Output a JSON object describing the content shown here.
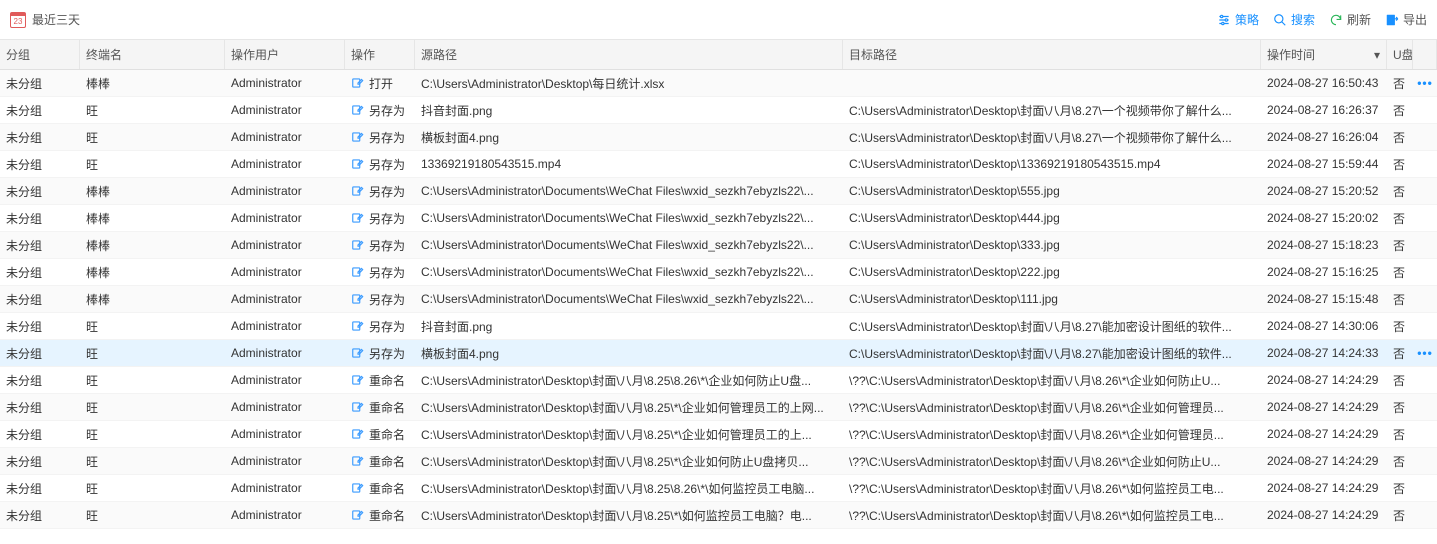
{
  "topbar": {
    "title": "最近三天",
    "cal_day": "23",
    "buttons": {
      "policy": "策略",
      "search": "搜索",
      "refresh": "刷新",
      "export": "导出"
    }
  },
  "columns": {
    "group": "分组",
    "terminal": "终端名",
    "user": "操作用户",
    "op": "操作",
    "src": "源路径",
    "dst": "目标路径",
    "time": "操作时间",
    "usb": "U盘"
  },
  "op_icons": {
    "open": {
      "stroke": "#4a90d9",
      "kind": "file"
    },
    "saveas": {
      "stroke": "#1890ff",
      "kind": "arrow-out"
    },
    "rename": {
      "stroke": "#1890ff",
      "kind": "edit"
    }
  },
  "rows": [
    {
      "group": "未分组",
      "terminal": "棒棒",
      "user": "Administrator",
      "op": "打开",
      "op_icon": "open",
      "src": "C:\\Users\\Administrator\\Desktop\\每日统计.xlsx",
      "dst": "",
      "time": "2024-08-27 16:50:43",
      "usb": "否",
      "menu": true
    },
    {
      "group": "未分组",
      "terminal": "旺",
      "user": "Administrator",
      "op": "另存为",
      "op_icon": "saveas",
      "src": "抖音封面.png",
      "dst": "C:\\Users\\Administrator\\Desktop\\封面\\八月\\8.27\\一个视频带你了解什么...",
      "time": "2024-08-27 16:26:37",
      "usb": "否"
    },
    {
      "group": "未分组",
      "terminal": "旺",
      "user": "Administrator",
      "op": "另存为",
      "op_icon": "saveas",
      "src": "横板封面4.png",
      "dst": "C:\\Users\\Administrator\\Desktop\\封面\\八月\\8.27\\一个视频带你了解什么...",
      "time": "2024-08-27 16:26:04",
      "usb": "否"
    },
    {
      "group": "未分组",
      "terminal": "旺",
      "user": "Administrator",
      "op": "另存为",
      "op_icon": "saveas",
      "src": "13369219180543515.mp4",
      "dst": "C:\\Users\\Administrator\\Desktop\\13369219180543515.mp4",
      "time": "2024-08-27 15:59:44",
      "usb": "否"
    },
    {
      "group": "未分组",
      "terminal": "棒棒",
      "user": "Administrator",
      "op": "另存为",
      "op_icon": "saveas",
      "src": "C:\\Users\\Administrator\\Documents\\WeChat Files\\wxid_sezkh7ebyzls22\\...",
      "dst": "C:\\Users\\Administrator\\Desktop\\555.jpg",
      "time": "2024-08-27 15:20:52",
      "usb": "否"
    },
    {
      "group": "未分组",
      "terminal": "棒棒",
      "user": "Administrator",
      "op": "另存为",
      "op_icon": "saveas",
      "src": "C:\\Users\\Administrator\\Documents\\WeChat Files\\wxid_sezkh7ebyzls22\\...",
      "dst": "C:\\Users\\Administrator\\Desktop\\444.jpg",
      "time": "2024-08-27 15:20:02",
      "usb": "否"
    },
    {
      "group": "未分组",
      "terminal": "棒棒",
      "user": "Administrator",
      "op": "另存为",
      "op_icon": "saveas",
      "src": "C:\\Users\\Administrator\\Documents\\WeChat Files\\wxid_sezkh7ebyzls22\\...",
      "dst": "C:\\Users\\Administrator\\Desktop\\333.jpg",
      "time": "2024-08-27 15:18:23",
      "usb": "否"
    },
    {
      "group": "未分组",
      "terminal": "棒棒",
      "user": "Administrator",
      "op": "另存为",
      "op_icon": "saveas",
      "src": "C:\\Users\\Administrator\\Documents\\WeChat Files\\wxid_sezkh7ebyzls22\\...",
      "dst": "C:\\Users\\Administrator\\Desktop\\222.jpg",
      "time": "2024-08-27 15:16:25",
      "usb": "否"
    },
    {
      "group": "未分组",
      "terminal": "棒棒",
      "user": "Administrator",
      "op": "另存为",
      "op_icon": "saveas",
      "src": "C:\\Users\\Administrator\\Documents\\WeChat Files\\wxid_sezkh7ebyzls22\\...",
      "dst": "C:\\Users\\Administrator\\Desktop\\111.jpg",
      "time": "2024-08-27 15:15:48",
      "usb": "否"
    },
    {
      "group": "未分组",
      "terminal": "旺",
      "user": "Administrator",
      "op": "另存为",
      "op_icon": "saveas",
      "src": "抖音封面.png",
      "dst": "C:\\Users\\Administrator\\Desktop\\封面\\八月\\8.27\\能加密设计图纸的软件...",
      "time": "2024-08-27 14:30:06",
      "usb": "否"
    },
    {
      "group": "未分组",
      "terminal": "旺",
      "user": "Administrator",
      "op": "另存为",
      "op_icon": "saveas",
      "src": "横板封面4.png",
      "dst": "C:\\Users\\Administrator\\Desktop\\封面\\八月\\8.27\\能加密设计图纸的软件...",
      "time": "2024-08-27 14:24:33",
      "usb": "否",
      "menu": true,
      "selected": true
    },
    {
      "group": "未分组",
      "terminal": "旺",
      "user": "Administrator",
      "op": "重命名",
      "op_icon": "rename",
      "src": "C:\\Users\\Administrator\\Desktop\\封面\\八月\\8.25\\8.26\\*\\企业如何防止U盘...",
      "dst": "\\??\\C:\\Users\\Administrator\\Desktop\\封面\\八月\\8.26\\*\\企业如何防止U...",
      "time": "2024-08-27 14:24:29",
      "usb": "否"
    },
    {
      "group": "未分组",
      "terminal": "旺",
      "user": "Administrator",
      "op": "重命名",
      "op_icon": "rename",
      "src": "C:\\Users\\Administrator\\Desktop\\封面\\八月\\8.25\\*\\企业如何管理员工的上网...",
      "dst": "\\??\\C:\\Users\\Administrator\\Desktop\\封面\\八月\\8.26\\*\\企业如何管理员...",
      "time": "2024-08-27 14:24:29",
      "usb": "否"
    },
    {
      "group": "未分组",
      "terminal": "旺",
      "user": "Administrator",
      "op": "重命名",
      "op_icon": "rename",
      "src": "C:\\Users\\Administrator\\Desktop\\封面\\八月\\8.25\\*\\企业如何管理员工的上...",
      "dst": "\\??\\C:\\Users\\Administrator\\Desktop\\封面\\八月\\8.26\\*\\企业如何管理员...",
      "time": "2024-08-27 14:24:29",
      "usb": "否"
    },
    {
      "group": "未分组",
      "terminal": "旺",
      "user": "Administrator",
      "op": "重命名",
      "op_icon": "rename",
      "src": "C:\\Users\\Administrator\\Desktop\\封面\\八月\\8.25\\*\\企业如何防止U盘拷贝...",
      "dst": "\\??\\C:\\Users\\Administrator\\Desktop\\封面\\八月\\8.26\\*\\企业如何防止U...",
      "time": "2024-08-27 14:24:29",
      "usb": "否"
    },
    {
      "group": "未分组",
      "terminal": "旺",
      "user": "Administrator",
      "op": "重命名",
      "op_icon": "rename",
      "src": "C:\\Users\\Administrator\\Desktop\\封面\\八月\\8.25\\8.26\\*\\如何监控员工电脑...",
      "dst": "\\??\\C:\\Users\\Administrator\\Desktop\\封面\\八月\\8.26\\*\\如何监控员工电...",
      "time": "2024-08-27 14:24:29",
      "usb": "否"
    },
    {
      "group": "未分组",
      "terminal": "旺",
      "user": "Administrator",
      "op": "重命名",
      "op_icon": "rename",
      "src": "C:\\Users\\Administrator\\Desktop\\封面\\八月\\8.25\\*\\如何监控员工电脑？电...",
      "dst": "\\??\\C:\\Users\\Administrator\\Desktop\\封面\\八月\\8.26\\*\\如何监控员工电...",
      "time": "2024-08-27 14:24:29",
      "usb": "否"
    }
  ]
}
